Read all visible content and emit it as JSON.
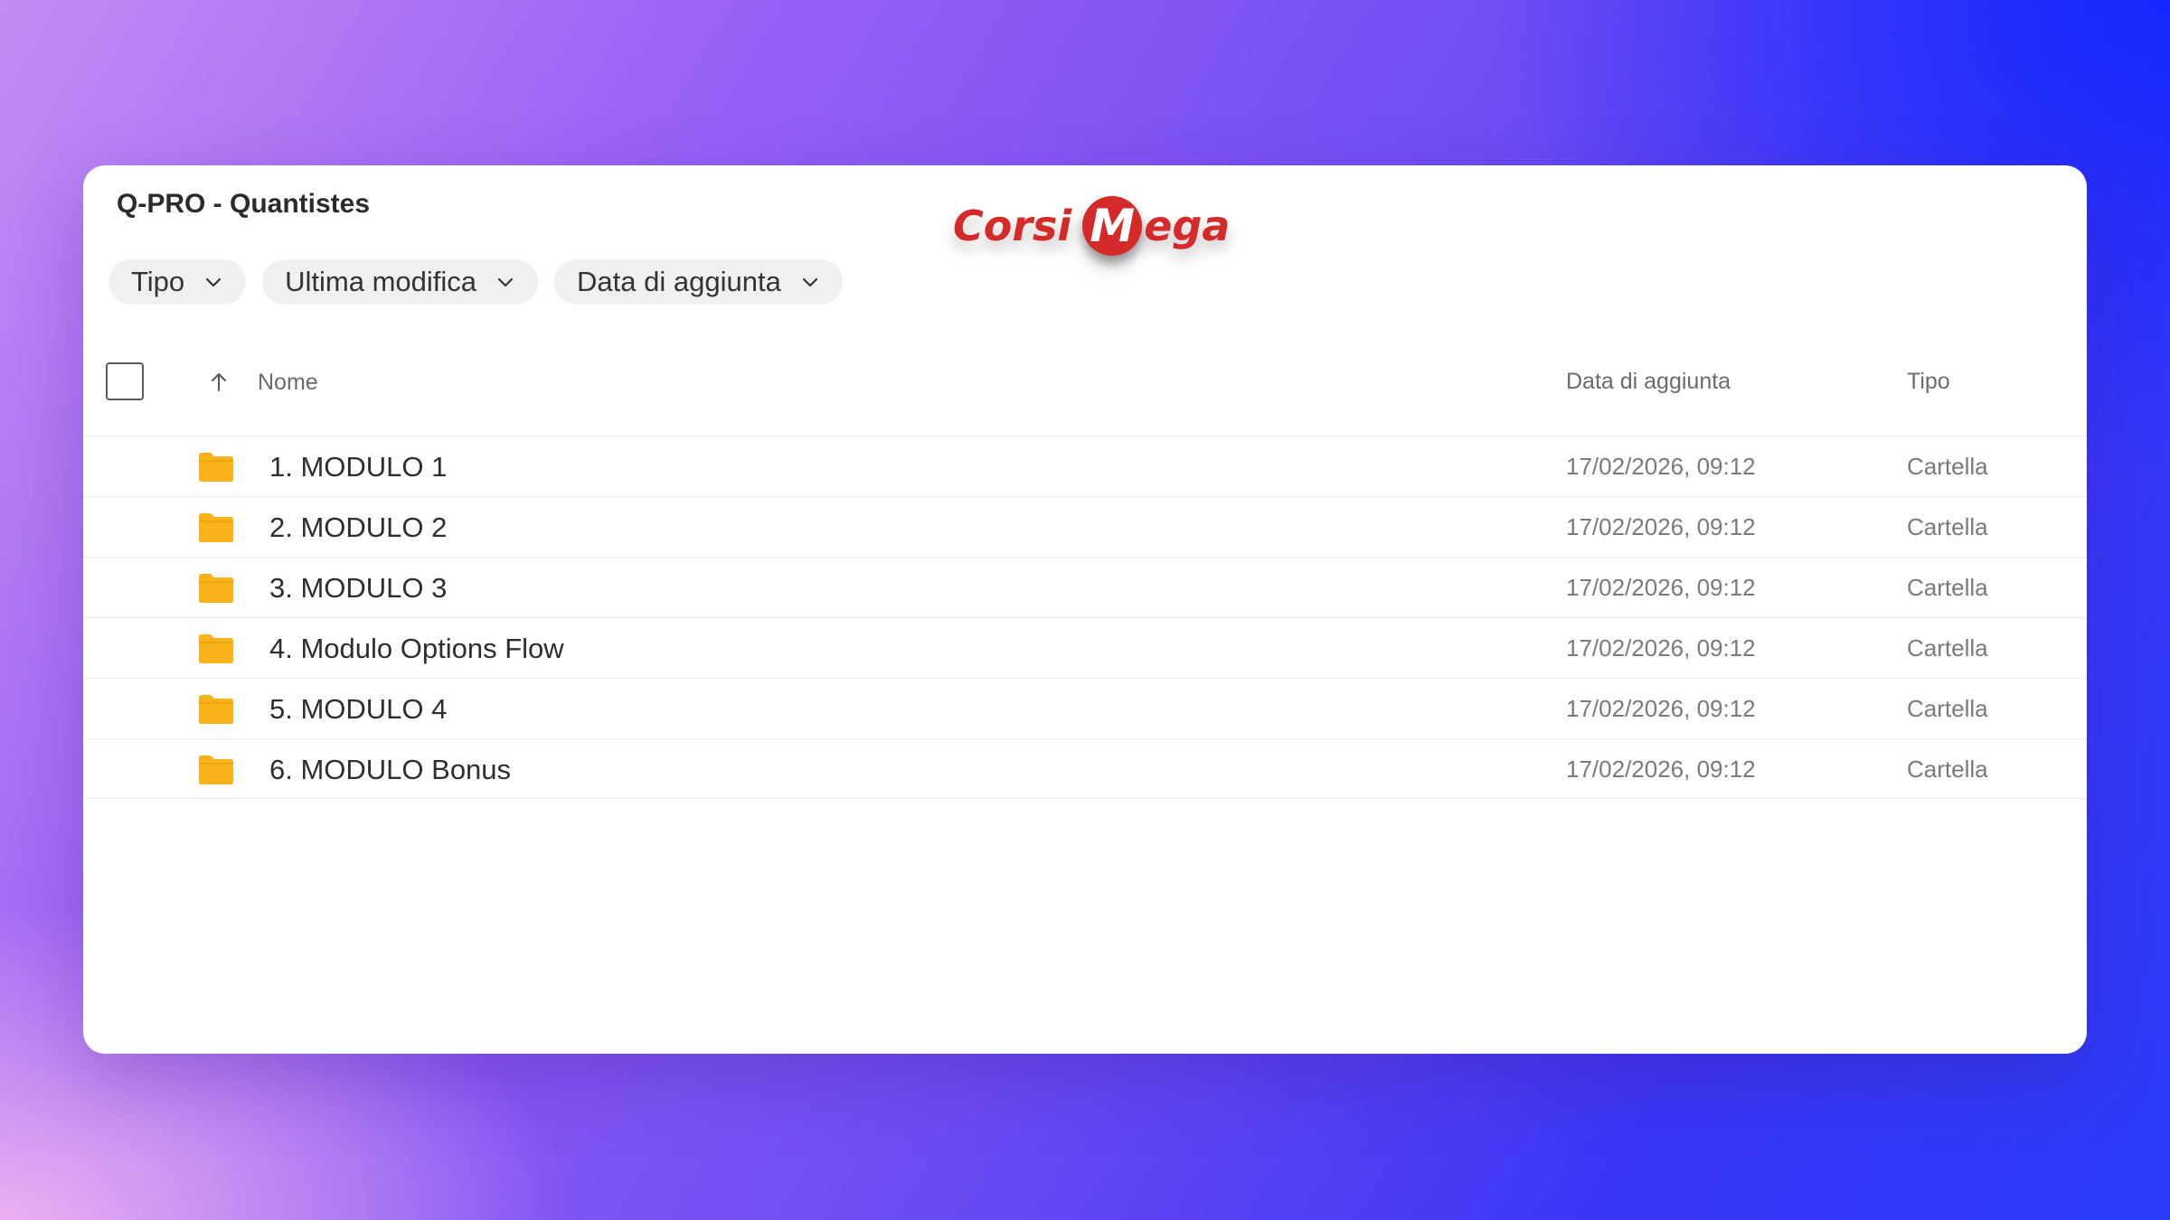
{
  "window": {
    "title": "Q-PRO - Quantistes"
  },
  "logo": {
    "text_before": "Corsi",
    "circle_letter": "M",
    "text_after": "ega",
    "color": "#d42a2a"
  },
  "filters": [
    {
      "label": "Tipo",
      "icon": "chevron-down-icon"
    },
    {
      "label": "Ultima modifica",
      "icon": "chevron-down-icon"
    },
    {
      "label": "Data di aggiunta",
      "icon": "chevron-down-icon"
    }
  ],
  "table": {
    "columns": {
      "name": "Nome",
      "date_added": "Data di aggiunta",
      "type": "Tipo"
    },
    "sort_icon": "arrow-up-icon",
    "rows": [
      {
        "name": "1. MODULO 1",
        "date_added": "17/02/2026, 09:12",
        "type": "Cartella",
        "icon": "folder-icon"
      },
      {
        "name": "2. MODULO 2",
        "date_added": "17/02/2026, 09:12",
        "type": "Cartella",
        "icon": "folder-icon"
      },
      {
        "name": "3. MODULO 3",
        "date_added": "17/02/2026, 09:12",
        "type": "Cartella",
        "icon": "folder-icon"
      },
      {
        "name": "4. Modulo Options Flow",
        "date_added": "17/02/2026, 09:12",
        "type": "Cartella",
        "icon": "folder-icon"
      },
      {
        "name": "5. MODULO 4",
        "date_added": "17/02/2026, 09:12",
        "type": "Cartella",
        "icon": "folder-icon"
      },
      {
        "name": "6. MODULO Bonus",
        "date_added": "17/02/2026, 09:12",
        "type": "Cartella",
        "icon": "folder-icon"
      }
    ]
  },
  "colors": {
    "folder": "#f9b21b",
    "background_left": "#c38cf3",
    "background_right": "#2a3cf7"
  }
}
